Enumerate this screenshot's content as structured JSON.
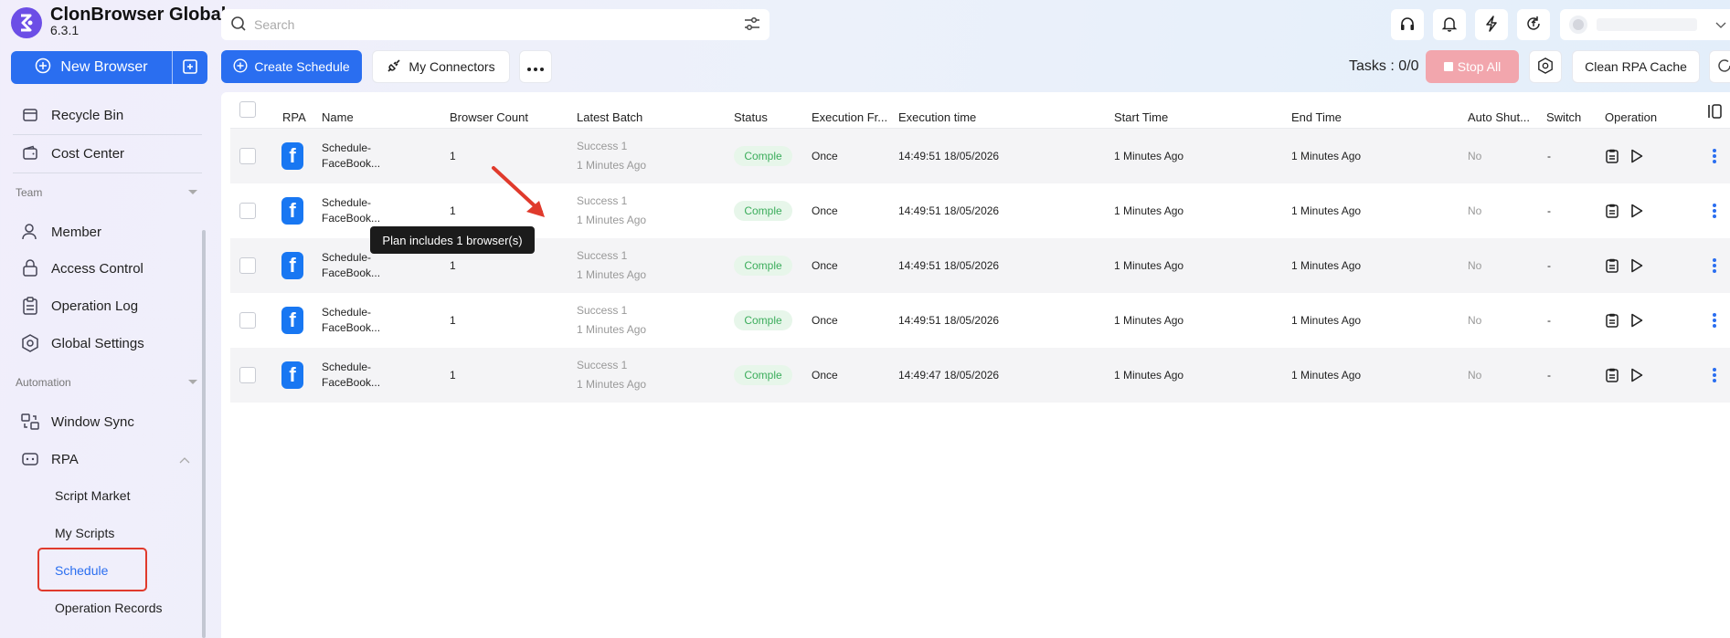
{
  "app": {
    "name": "ClonBrowser Global",
    "version": "6.3.1"
  },
  "sidebar": {
    "new_browser_label": "New Browser",
    "top_items": [
      {
        "label": "Recycle Bin",
        "icon": "recycle-bin-icon"
      },
      {
        "label": "Cost Center",
        "icon": "wallet-icon"
      }
    ],
    "team_section": "Team",
    "team_items": [
      {
        "label": "Member",
        "icon": "user-icon"
      },
      {
        "label": "Access Control",
        "icon": "lock-icon"
      },
      {
        "label": "Operation Log",
        "icon": "clipboard-icon"
      },
      {
        "label": "Global Settings",
        "icon": "hexagon-gear-icon"
      }
    ],
    "automation_section": "Automation",
    "automation_items": [
      {
        "label": "Window Sync",
        "icon": "sync-windows-icon"
      },
      {
        "label": "RPA",
        "icon": "robot-icon"
      }
    ],
    "rpa_sub_items": [
      {
        "label": "Script Market"
      },
      {
        "label": "My Scripts"
      },
      {
        "label": "Schedule",
        "active": true
      },
      {
        "label": "Operation Records"
      }
    ]
  },
  "search": {
    "placeholder": "Search"
  },
  "toolbar": {
    "create_schedule": "Create Schedule",
    "my_connectors": "My Connectors",
    "tasks_label": "Tasks : 0/0",
    "stop_all": "Stop All",
    "clean_cache": "Clean RPA Cache"
  },
  "table": {
    "headers": {
      "rpa": "RPA",
      "name": "Name",
      "browser_count": "Browser Count",
      "latest_batch": "Latest Batch",
      "status": "Status",
      "execution_freq": "Execution Fr...",
      "execution_time": "Execution time",
      "start_time": "Start Time",
      "end_time": "End Time",
      "auto_shutdown": "Auto Shut...",
      "switch": "Switch",
      "operation": "Operation"
    },
    "rows": [
      {
        "name_1": "Schedule-",
        "name_2": "FaceBook...",
        "count": "1",
        "batch_1": "Success 1",
        "batch_2": "1 Minutes Ago",
        "status": "Comple",
        "freq": "Once",
        "exec_time": "14:49:51 18/05/2026",
        "start": "1 Minutes Ago",
        "end": "1 Minutes Ago",
        "auto": "No",
        "switch": "-"
      },
      {
        "name_1": "Schedule-",
        "name_2": "FaceBook...",
        "count": "1",
        "batch_1": "Success 1",
        "batch_2": "1 Minutes Ago",
        "status": "Comple",
        "freq": "Once",
        "exec_time": "14:49:51 18/05/2026",
        "start": "1 Minutes Ago",
        "end": "1 Minutes Ago",
        "auto": "No",
        "switch": "-"
      },
      {
        "name_1": "Schedule-",
        "name_2": "FaceBook...",
        "count": "1",
        "batch_1": "Success 1",
        "batch_2": "1 Minutes Ago",
        "status": "Comple",
        "freq": "Once",
        "exec_time": "14:49:51 18/05/2026",
        "start": "1 Minutes Ago",
        "end": "1 Minutes Ago",
        "auto": "No",
        "switch": "-"
      },
      {
        "name_1": "Schedule-",
        "name_2": "FaceBook...",
        "count": "1",
        "batch_1": "Success 1",
        "batch_2": "1 Minutes Ago",
        "status": "Comple",
        "freq": "Once",
        "exec_time": "14:49:51 18/05/2026",
        "start": "1 Minutes Ago",
        "end": "1 Minutes Ago",
        "auto": "No",
        "switch": "-"
      },
      {
        "name_1": "Schedule-",
        "name_2": "FaceBook...",
        "count": "1",
        "batch_1": "Success 1",
        "batch_2": "1 Minutes Ago",
        "status": "Comple",
        "freq": "Once",
        "exec_time": "14:49:47 18/05/2026",
        "start": "1 Minutes Ago",
        "end": "1 Minutes Ago",
        "auto": "No",
        "switch": "-"
      }
    ]
  },
  "tooltip": "Plan includes 1 browser(s)",
  "colors": {
    "primary": "#2a6ef0",
    "logo": "#6c4ee6",
    "status_green": "#3cad5c",
    "stop_pink": "#f2a6ad",
    "annotation_red": "#e03a2c",
    "facebook": "#1877f2"
  }
}
